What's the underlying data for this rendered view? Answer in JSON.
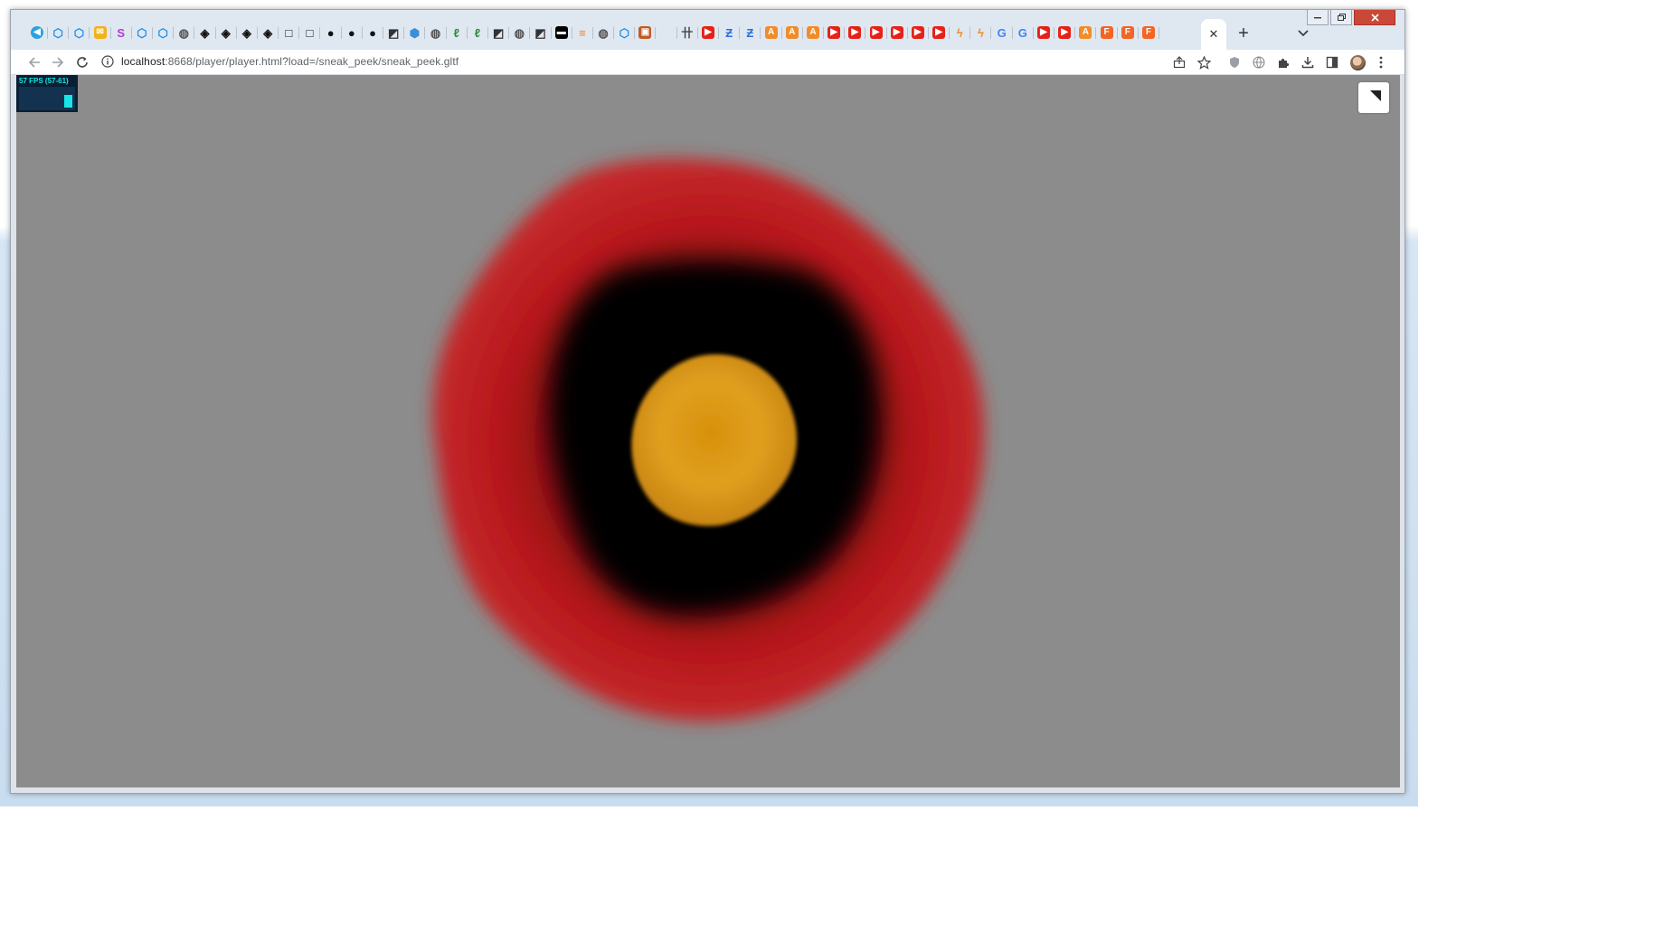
{
  "browser": {
    "url_host": "localhost",
    "url_path": ":8668/player/player.html?load=/sneak_peek/sneak_peek.gltf",
    "tabs": [
      {
        "icon": "telegram-icon",
        "color": "#2aa3de",
        "glyph": "◀"
      },
      {
        "icon": "proton-icon",
        "color": "#1a8fe8",
        "glyph": "⬡"
      },
      {
        "icon": "proton-icon",
        "color": "#1a8fe8",
        "glyph": "⬡"
      },
      {
        "icon": "mail-icon",
        "color": "#f1b21a",
        "glyph": "✉"
      },
      {
        "icon": "circle-s-icon",
        "color": "#b13ad0",
        "glyph": "S"
      },
      {
        "icon": "proton-icon",
        "color": "#1a8fe8",
        "glyph": "⬡"
      },
      {
        "icon": "proton-icon",
        "color": "#1a8fe8",
        "glyph": "⬡"
      },
      {
        "icon": "globe-icon",
        "color": "#555555",
        "glyph": "◍"
      },
      {
        "icon": "codepen-icon",
        "color": "#111111",
        "glyph": "◈"
      },
      {
        "icon": "codepen-icon",
        "color": "#111111",
        "glyph": "◈"
      },
      {
        "icon": "codepen-icon",
        "color": "#111111",
        "glyph": "◈"
      },
      {
        "icon": "codepen-icon",
        "color": "#111111",
        "glyph": "◈"
      },
      {
        "icon": "square-icon",
        "color": "#111111",
        "glyph": "□"
      },
      {
        "icon": "square-icon",
        "color": "#111111",
        "glyph": "□"
      },
      {
        "icon": "github-icon",
        "color": "#111111",
        "glyph": "●"
      },
      {
        "icon": "github-icon",
        "color": "#111111",
        "glyph": "●"
      },
      {
        "icon": "github-icon",
        "color": "#111111",
        "glyph": "●"
      },
      {
        "icon": "vercel-icon",
        "color": "#333333",
        "glyph": "◩"
      },
      {
        "icon": "cube-icon",
        "color": "#3a8fd6",
        "glyph": "⬢"
      },
      {
        "icon": "globe-icon",
        "color": "#555555",
        "glyph": "◍"
      },
      {
        "icon": "leaf-icon",
        "color": "#2e8b3a",
        "glyph": "ℓ"
      },
      {
        "icon": "leaf-icon",
        "color": "#2e8b3a",
        "glyph": "ℓ"
      },
      {
        "icon": "vercel-icon",
        "color": "#333333",
        "glyph": "◩"
      },
      {
        "icon": "globe-icon",
        "color": "#555555",
        "glyph": "◍"
      },
      {
        "icon": "vercel-icon",
        "color": "#333333",
        "glyph": "◩"
      },
      {
        "icon": "terminal-icon",
        "color": "#000000",
        "glyph": "▬"
      },
      {
        "icon": "stackoverflow-icon",
        "color": "#f48024",
        "glyph": "≡"
      },
      {
        "icon": "globe-icon",
        "color": "#555555",
        "glyph": "◍"
      },
      {
        "icon": "proton-icon",
        "color": "#1a8fe8",
        "glyph": "⬡"
      },
      {
        "icon": "app-icon",
        "color": "#c05a25",
        "glyph": "▣"
      },
      {
        "icon": "apple-icon",
        "color": "#777777",
        "glyph": ""
      },
      {
        "icon": "hieroglyph-icon",
        "color": "#444444",
        "glyph": "卄"
      },
      {
        "icon": "youtube-icon",
        "color": "#e62117",
        "glyph": "▶"
      },
      {
        "icon": "chart-icon",
        "color": "#2d6fd6",
        "glyph": "Ƶ"
      },
      {
        "icon": "chart-icon",
        "color": "#2d6fd6",
        "glyph": "Ƶ"
      },
      {
        "icon": "a-icon",
        "color": "#f28c28",
        "glyph": "A"
      },
      {
        "icon": "a-icon",
        "color": "#f28c28",
        "glyph": "A"
      },
      {
        "icon": "a-icon",
        "color": "#f28c28",
        "glyph": "A"
      },
      {
        "icon": "youtube-icon",
        "color": "#e62117",
        "glyph": "▶"
      },
      {
        "icon": "youtube-icon",
        "color": "#e62117",
        "glyph": "▶"
      },
      {
        "icon": "youtube-icon",
        "color": "#e62117",
        "glyph": "▶"
      },
      {
        "icon": "youtube-icon",
        "color": "#e62117",
        "glyph": "▶"
      },
      {
        "icon": "youtube-icon",
        "color": "#e62117",
        "glyph": "▶"
      },
      {
        "icon": "youtube-icon",
        "color": "#e62117",
        "glyph": "▶"
      },
      {
        "icon": "bolt-icon",
        "color": "#f28c28",
        "glyph": "ϟ"
      },
      {
        "icon": "bolt-icon",
        "color": "#f28c28",
        "glyph": "ϟ"
      },
      {
        "icon": "google-icon",
        "color": "#4285f4",
        "glyph": "G"
      },
      {
        "icon": "google-icon",
        "color": "#4285f4",
        "glyph": "G"
      },
      {
        "icon": "youtube-icon",
        "color": "#e62117",
        "glyph": "▶"
      },
      {
        "icon": "youtube-icon",
        "color": "#e62117",
        "glyph": "▶"
      },
      {
        "icon": "a-icon",
        "color": "#f28c28",
        "glyph": "A"
      },
      {
        "icon": "f-icon",
        "color": "#f26522",
        "glyph": "F"
      },
      {
        "icon": "f-icon",
        "color": "#f26522",
        "glyph": "F"
      },
      {
        "icon": "f-icon",
        "color": "#f26522",
        "glyph": "F"
      }
    ]
  },
  "player": {
    "fps_label": "57 FPS (57-61)",
    "fps_level": 0.55
  },
  "colors": {
    "background": "#8c8c8c",
    "outer_ring": "#b8181c",
    "inner_void": "#050505",
    "core": "#e0980e"
  }
}
